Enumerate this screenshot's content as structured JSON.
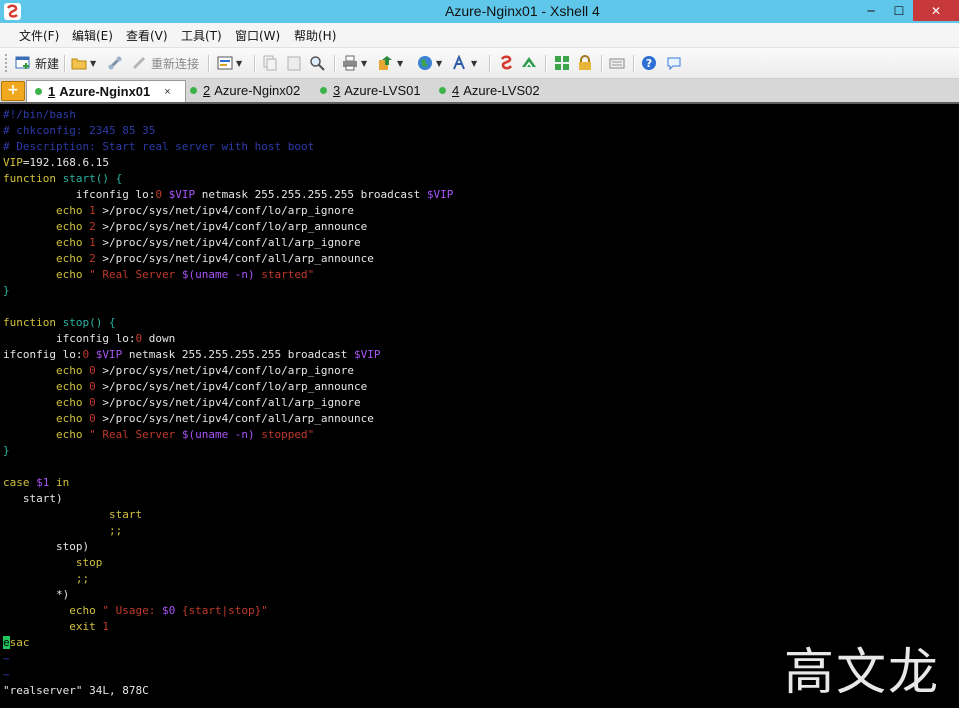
{
  "window": {
    "title": "Azure-Nginx01 - Xshell 4",
    "minimize": "─",
    "maximize": "☐",
    "close": "✕"
  },
  "menu": [
    "文件(F)",
    "编辑(E)",
    "查看(V)",
    "工具(T)",
    "窗口(W)",
    "帮助(H)"
  ],
  "toolbar": {
    "new_label": "新建",
    "reconnect_label": "重新连接"
  },
  "tabs": [
    {
      "num": "1",
      "label": "Azure-Nginx01",
      "active": true
    },
    {
      "num": "2",
      "label": "Azure-Nginx02",
      "active": false
    },
    {
      "num": "3",
      "label": "Azure-LVS01",
      "active": false
    },
    {
      "num": "4",
      "label": "Azure-LVS02",
      "active": false
    }
  ],
  "tab_close_glyph": "×",
  "add_tab_glyph": "+",
  "colors": {
    "comment": "#2c3ba8",
    "keyword": "#d1c13c",
    "text": "#e6e6e6",
    "number": "#c0392b",
    "variable": "#a855f7",
    "string": "#c0392b",
    "brace": "#2bb3a5",
    "cursor": "#22c55e",
    "tilde": "#2c3ba8"
  },
  "terminal_lines": [
    [
      [
        "#!/bin/bash",
        "comment"
      ]
    ],
    [
      [
        "# chkconfig: 2345 85 35",
        "comment"
      ]
    ],
    [
      [
        "# Description: Start real server with host boot",
        "comment"
      ]
    ],
    [
      [
        "VIP",
        "keyword"
      ],
      [
        "=192.168.6.15",
        "text"
      ]
    ],
    [
      [
        "function",
        "keyword"
      ],
      [
        " ",
        "text"
      ],
      [
        "start() {",
        "brace"
      ]
    ],
    [
      [
        "           ifconfig lo:",
        "text"
      ],
      [
        "0",
        "number"
      ],
      [
        " ",
        "text"
      ],
      [
        "$VIP",
        "variable"
      ],
      [
        " netmask 255.255.255.255 broadcast ",
        "text"
      ],
      [
        "$VIP",
        "variable"
      ]
    ],
    [
      [
        "        echo",
        "keyword"
      ],
      [
        " ",
        "text"
      ],
      [
        "1",
        "number"
      ],
      [
        " >/proc/sys/net/ipv4/conf/lo/arp_ignore",
        "text"
      ]
    ],
    [
      [
        "        echo",
        "keyword"
      ],
      [
        " ",
        "text"
      ],
      [
        "2",
        "number"
      ],
      [
        " >/proc/sys/net/ipv4/conf/lo/arp_announce",
        "text"
      ]
    ],
    [
      [
        "        echo",
        "keyword"
      ],
      [
        " ",
        "text"
      ],
      [
        "1",
        "number"
      ],
      [
        " >/proc/sys/net/ipv4/conf/all/arp_ignore",
        "text"
      ]
    ],
    [
      [
        "        echo",
        "keyword"
      ],
      [
        " ",
        "text"
      ],
      [
        "2",
        "number"
      ],
      [
        " >/proc/sys/net/ipv4/conf/all/arp_announce",
        "text"
      ]
    ],
    [
      [
        "        echo",
        "keyword"
      ],
      [
        " \" Real Server ",
        "string"
      ],
      [
        "$(uname -n)",
        "variable"
      ],
      [
        " started\"",
        "string"
      ]
    ],
    [
      [
        "}",
        "brace"
      ]
    ],
    [
      [
        "",
        "text"
      ]
    ],
    [
      [
        "function",
        "keyword"
      ],
      [
        " ",
        "text"
      ],
      [
        "stop() {",
        "brace"
      ]
    ],
    [
      [
        "        ifconfig lo:",
        "text"
      ],
      [
        "0",
        "number"
      ],
      [
        " down",
        "text"
      ]
    ],
    [
      [
        "ifconfig lo:",
        "text"
      ],
      [
        "0",
        "number"
      ],
      [
        " ",
        "text"
      ],
      [
        "$VIP",
        "variable"
      ],
      [
        " netmask 255.255.255.255 broadcast ",
        "text"
      ],
      [
        "$VIP",
        "variable"
      ]
    ],
    [
      [
        "        echo",
        "keyword"
      ],
      [
        " ",
        "text"
      ],
      [
        "0",
        "number"
      ],
      [
        " >/proc/sys/net/ipv4/conf/lo/arp_ignore",
        "text"
      ]
    ],
    [
      [
        "        echo",
        "keyword"
      ],
      [
        " ",
        "text"
      ],
      [
        "0",
        "number"
      ],
      [
        " >/proc/sys/net/ipv4/conf/lo/arp_announce",
        "text"
      ]
    ],
    [
      [
        "        echo",
        "keyword"
      ],
      [
        " ",
        "text"
      ],
      [
        "0",
        "number"
      ],
      [
        " >/proc/sys/net/ipv4/conf/all/arp_ignore",
        "text"
      ]
    ],
    [
      [
        "        echo",
        "keyword"
      ],
      [
        " ",
        "text"
      ],
      [
        "0",
        "number"
      ],
      [
        " >/proc/sys/net/ipv4/conf/all/arp_announce",
        "text"
      ]
    ],
    [
      [
        "        echo",
        "keyword"
      ],
      [
        " \" Real Server ",
        "string"
      ],
      [
        "$(uname -n)",
        "variable"
      ],
      [
        " stopped\"",
        "string"
      ]
    ],
    [
      [
        "}",
        "brace"
      ]
    ],
    [
      [
        "",
        "text"
      ]
    ],
    [
      [
        "case",
        "keyword"
      ],
      [
        " ",
        "text"
      ],
      [
        "$1",
        "variable"
      ],
      [
        " ",
        "text"
      ],
      [
        "in",
        "keyword"
      ]
    ],
    [
      [
        "   start)",
        "text"
      ]
    ],
    [
      [
        "                start",
        "keyword"
      ]
    ],
    [
      [
        "                ;;",
        "keyword"
      ]
    ],
    [
      [
        "        stop)",
        "text"
      ]
    ],
    [
      [
        "           stop",
        "keyword"
      ]
    ],
    [
      [
        "           ;;",
        "keyword"
      ]
    ],
    [
      [
        "        *)",
        "text"
      ]
    ],
    [
      [
        "          echo",
        "keyword"
      ],
      [
        " \" Usage: ",
        "string"
      ],
      [
        "$0",
        "variable"
      ],
      [
        " {start|stop}\"",
        "string"
      ]
    ],
    [
      [
        "          exit",
        "keyword"
      ],
      [
        " ",
        "text"
      ],
      [
        "1",
        "number"
      ]
    ],
    [
      [
        "e",
        "cursor"
      ],
      [
        "sac",
        "keyword"
      ]
    ],
    [
      [
        "~",
        "tilde"
      ]
    ],
    [
      [
        "~",
        "tilde"
      ]
    ],
    [
      [
        "\"realserver\" 34L, 878C",
        "text"
      ]
    ]
  ],
  "watermark": "高文龙"
}
